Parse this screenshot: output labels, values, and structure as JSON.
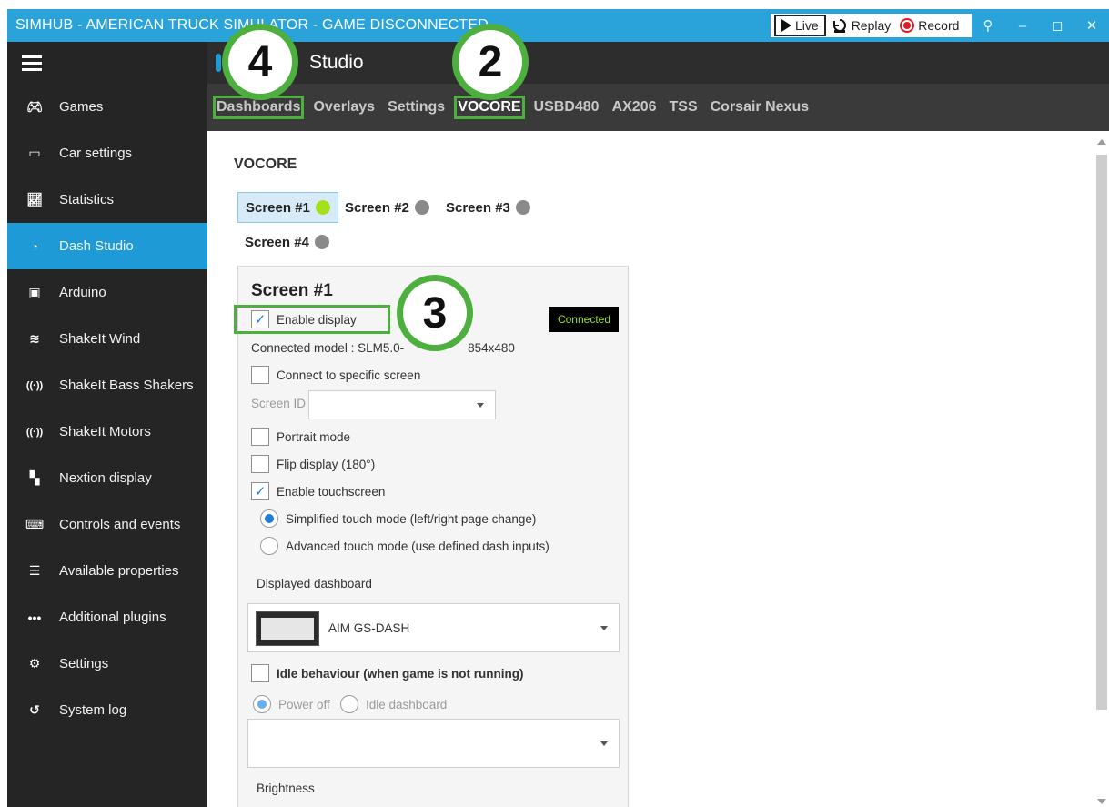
{
  "titlebar": {
    "title": "SIMHUB - AMERICAN TRUCK SIMULATOR - GAME DISCONNECTED",
    "live": "Live",
    "replay": "Replay",
    "record": "Record"
  },
  "header": {
    "title": "Studio"
  },
  "tabs": [
    {
      "label": "Dashboards",
      "active": false
    },
    {
      "label": "Overlays",
      "active": false
    },
    {
      "label": "Settings",
      "active": false
    },
    {
      "label": "VOCORE",
      "active": true
    },
    {
      "label": "USBD480",
      "active": false
    },
    {
      "label": "AX206",
      "active": false
    },
    {
      "label": "TSS",
      "active": false
    },
    {
      "label": "Corsair Nexus",
      "active": false
    }
  ],
  "sidebar": {
    "items": [
      {
        "label": "Games",
        "icon": "gamepad-icon"
      },
      {
        "label": "Car settings",
        "icon": "car-icon"
      },
      {
        "label": "Statistics",
        "icon": "chart-icon"
      },
      {
        "label": "Dash Studio",
        "icon": "gauge-icon",
        "active": true
      },
      {
        "label": "Arduino",
        "icon": "board-icon"
      },
      {
        "label": "ShakeIt Wind",
        "icon": "wind-icon"
      },
      {
        "label": "ShakeIt Bass Shakers",
        "icon": "vibration-icon"
      },
      {
        "label": "ShakeIt Motors",
        "icon": "vibration-icon"
      },
      {
        "label": "Nextion display",
        "icon": "nextion-icon"
      },
      {
        "label": "Controls and events",
        "icon": "keyboard-icon"
      },
      {
        "label": "Available properties",
        "icon": "list-icon"
      },
      {
        "label": "Additional plugins",
        "icon": "dots-icon"
      },
      {
        "label": "Settings",
        "icon": "gear-icon"
      },
      {
        "label": "System log",
        "icon": "history-icon"
      }
    ]
  },
  "content": {
    "section_title": "VOCORE",
    "screens": [
      {
        "label": "Screen #1",
        "status": "on"
      },
      {
        "label": "Screen #2",
        "status": "off"
      },
      {
        "label": "Screen #3",
        "status": "off"
      },
      {
        "label": "Screen #4",
        "status": "off"
      }
    ],
    "panel": {
      "title": "Screen #1",
      "enable_display": "Enable display",
      "connected_badge": "Connected",
      "connected_model_prefix": "Connected model : SLM5.0-",
      "connected_model_suffix": "854x480",
      "connect_specific": "Connect to specific screen",
      "screen_id_label": "Screen ID :",
      "screen_id_value": "",
      "portrait_mode": "Portrait mode",
      "flip_display": "Flip display (180°)",
      "enable_touchscreen": "Enable touchscreen",
      "simplified_touch": "Simplified touch mode (left/right page change)",
      "advanced_touch": "Advanced touch mode (use defined dash inputs)",
      "displayed_dashboard_label": "Displayed dashboard",
      "displayed_dashboard_value": "AIM GS-DASH",
      "idle_behaviour": "Idle behaviour (when game is not running)",
      "power_off": "Power off",
      "idle_dashboard": "Idle dashboard",
      "idle_select_value": "",
      "brightness_label": "Brightness"
    }
  },
  "annotations": {
    "badge_4": "4",
    "badge_2": "2",
    "badge_3": "3"
  },
  "colors": {
    "titlebar": "#2aa3db",
    "accent": "#1e9bd7",
    "highlight": "#4caf3e",
    "connected_text": "#a5e01d"
  }
}
